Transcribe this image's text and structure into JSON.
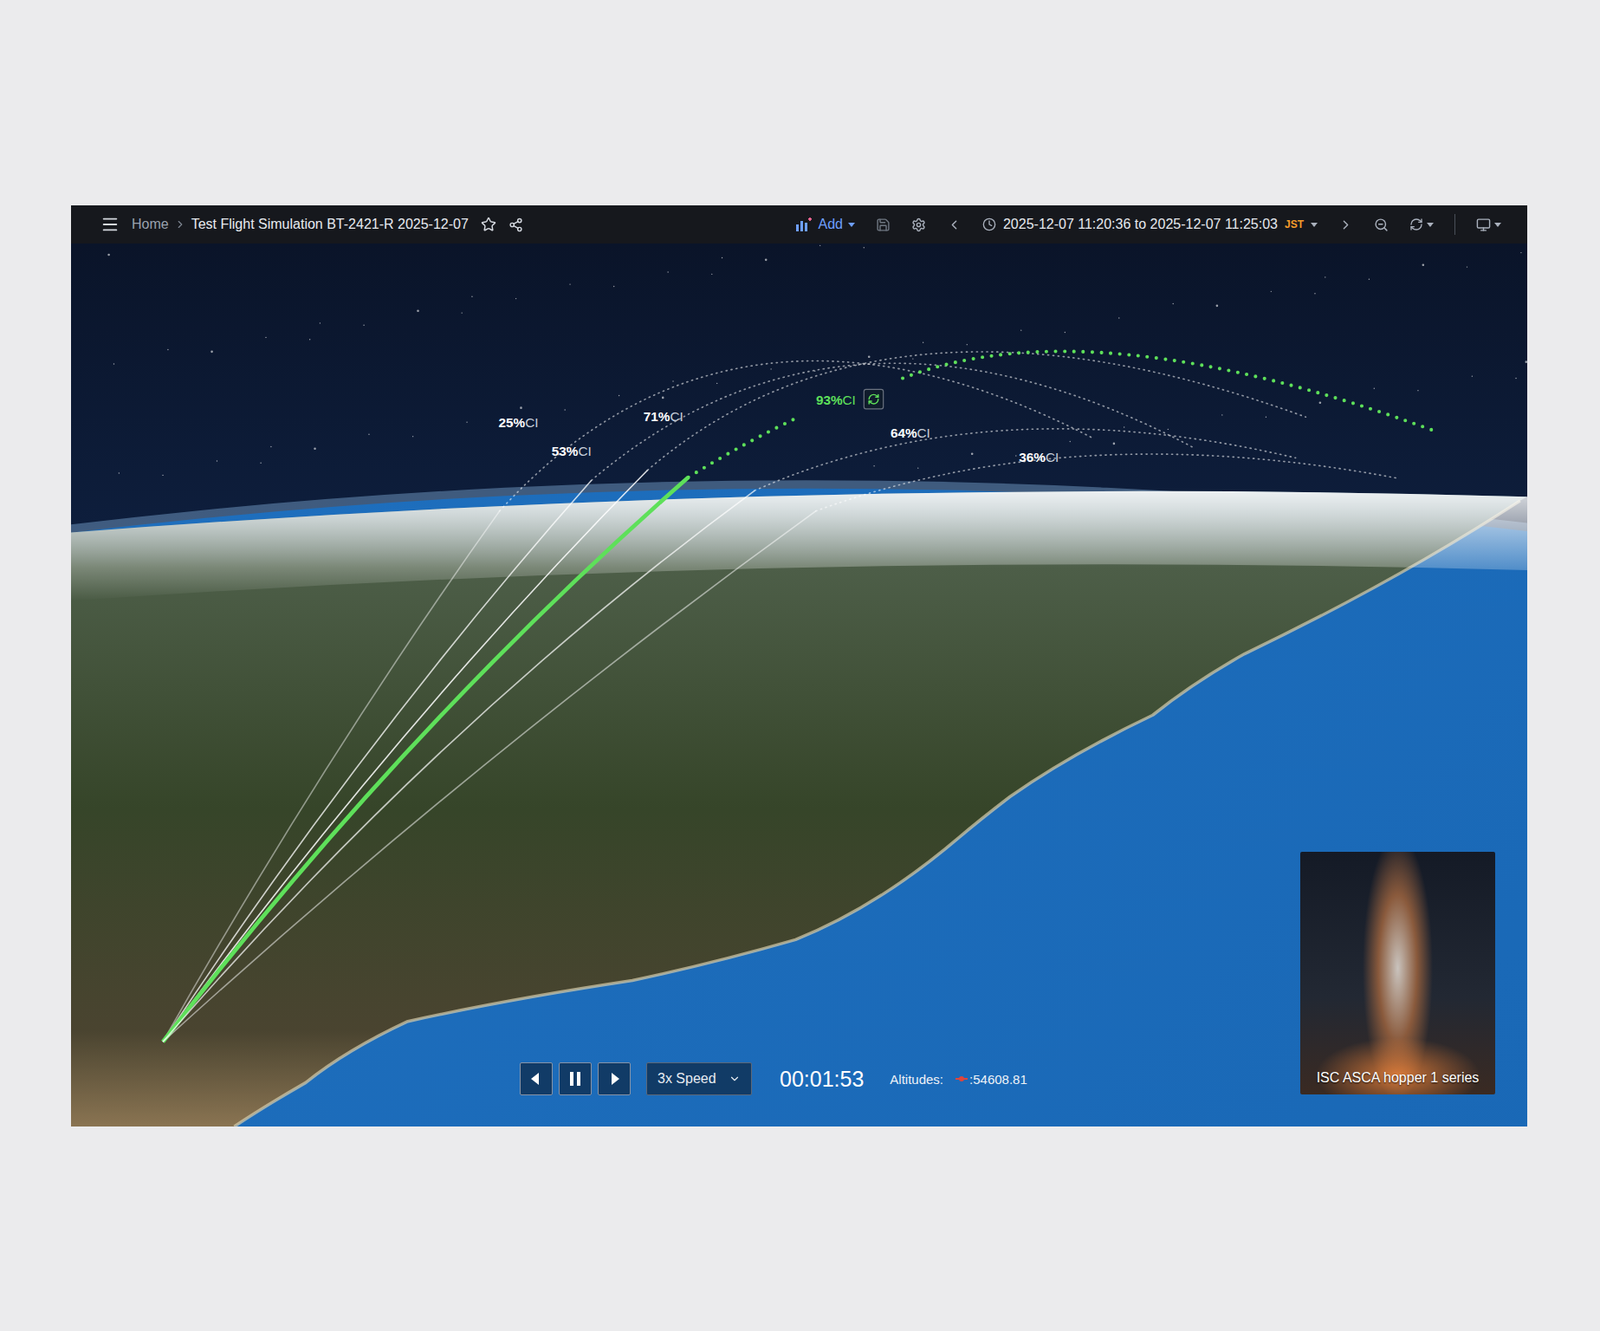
{
  "toolbar": {
    "breadcrumb": [
      "Home",
      "Test Flight Simulation BT-2421-R 2025-12-07"
    ],
    "starred": false,
    "add_button": "Add",
    "time_range": {
      "from": "2025-12-07 11:20:36",
      "separator": "to",
      "to": "2025-12-07 11:25:03",
      "timezone": "JST"
    }
  },
  "trajectories": [
    {
      "value": "25%",
      "unit": "CI",
      "selected": false
    },
    {
      "value": "53%",
      "unit": "CI",
      "selected": false
    },
    {
      "value": "71%",
      "unit": "CI",
      "selected": false
    },
    {
      "value": "93%",
      "unit": "CI",
      "selected": true
    },
    {
      "value": "64%",
      "unit": "CI",
      "selected": false
    },
    {
      "value": "36%",
      "unit": "CI",
      "selected": false
    }
  ],
  "playback": {
    "playing": true,
    "speed": "3x Speed",
    "elapsed": "00:01:53",
    "altitude_label": "Altitudes:",
    "altitude_value": ":54608.81",
    "series_color": "#e0463c"
  },
  "camera": {
    "caption": "ISC ASCA hopper 1 series"
  }
}
